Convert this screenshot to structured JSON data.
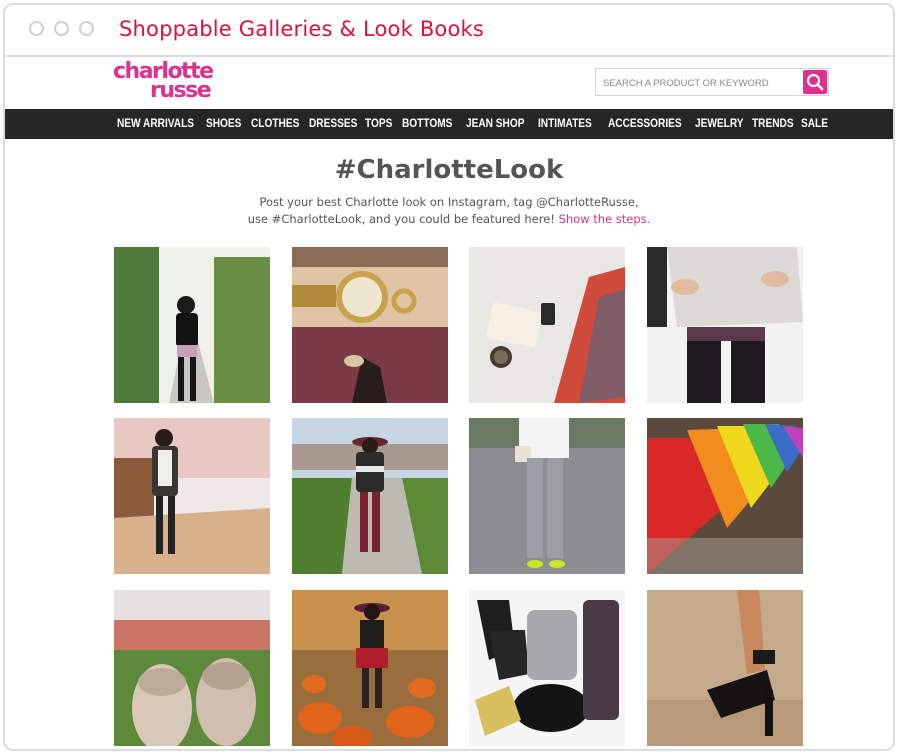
{
  "window": {
    "title": "Shoppable Galleries & Look Books"
  },
  "brand": {
    "logo_line1": "charlotte",
    "logo_line2": "russe",
    "color": "#e0308f"
  },
  "search": {
    "placeholder": "SEARCH A PRODUCT OR KEYWORD",
    "icon": "magnifier"
  },
  "nav": {
    "items": [
      {
        "label": "NEW ARRIVALS"
      },
      {
        "label": "SHOES"
      },
      {
        "label": "CLOTHES"
      },
      {
        "label": "DRESSES"
      },
      {
        "label": "TOPS"
      },
      {
        "label": "BOTTOMS"
      },
      {
        "label": "JEAN SHOP"
      },
      {
        "label": "INTIMATES"
      },
      {
        "label": "ACCESSORIES"
      },
      {
        "label": "JEWELRY"
      },
      {
        "label": "TRENDS"
      },
      {
        "label": "SALE"
      }
    ]
  },
  "main": {
    "heading": "#CharlotteLook",
    "subtitle_line1": "Post your best Charlotte look on Instagram, tag @CharlotteRusse,",
    "subtitle_line2": "use #CharlotteLook, and you could be featured here!",
    "show_steps_link": "Show the steps."
  },
  "gallery": {
    "photos": [
      {
        "subject": "outfit-photo-garden-path"
      },
      {
        "subject": "wrist-watch-bracelets"
      },
      {
        "subject": "printed-leggings-flatlay"
      },
      {
        "subject": "patterned-tights-sweater"
      },
      {
        "subject": "outfit-photo-autumn-sidewalk"
      },
      {
        "subject": "outfit-photo-hat-burgundy-jeans"
      },
      {
        "subject": "gray-jeans-neon-heels"
      },
      {
        "subject": "rainbow-heels-row"
      },
      {
        "subject": "oxford-shoes-park"
      },
      {
        "subject": "outfit-photo-pumpkin-patch"
      },
      {
        "subject": "outfit-flatlay-booties-skirt"
      },
      {
        "subject": "black-platform-sandals"
      }
    ]
  },
  "colors": {
    "title_red": "#e0103c",
    "accent_pink": "#e0308f",
    "nav_bg": "#262626"
  }
}
